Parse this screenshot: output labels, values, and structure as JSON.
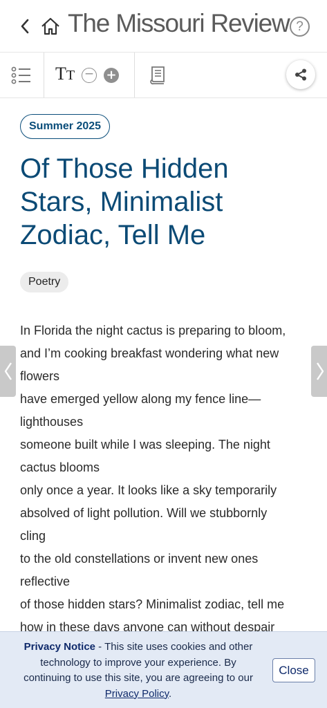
{
  "header": {
    "title": "The Missouri Review",
    "back_icon": "chevron-left-icon",
    "home_icon": "home-icon",
    "help_label": "?"
  },
  "toolbar": {
    "font_size_label_big": "T",
    "font_size_label_small": "T",
    "decrease_label": "−",
    "increase_label": "+"
  },
  "article": {
    "issue": "Summer 2025",
    "title": "Of Those Hidden Stars, Minimalist Zodiac, Tell Me",
    "genre": "Poetry",
    "lines": [
      "In Florida the night cactus is preparing to bloom,",
      "and I’m cooking breakfast wondering what new",
      "flowers",
      "have emerged yellow along my fence line—",
      "lighthouses",
      "someone built while I was sleeping. The night",
      "cactus blooms",
      "only once a year. It looks like a sky temporarily",
      "absolved of light pollution. Will we stubbornly",
      "cling",
      "to the old constellations or invent new ones",
      "reflective",
      "of those hidden stars? Minimalist zodiac, tell me",
      "how in these days anyone can without despair"
    ]
  },
  "nav": {
    "prev_label": "‹",
    "next_label": "›"
  },
  "privacy": {
    "heading": "Privacy Notice",
    "text_before_link": " - This site uses cookies and other technology to improve your experience. By continuing to use this site, you are agreeing to our ",
    "link": "Privacy Policy",
    "text_after_link": ".",
    "close_label": "Close"
  },
  "colors": {
    "title_blue": "#0b4a75",
    "badge_blue": "#0a4d7a",
    "privacy_bg": "#e3eaf5"
  }
}
